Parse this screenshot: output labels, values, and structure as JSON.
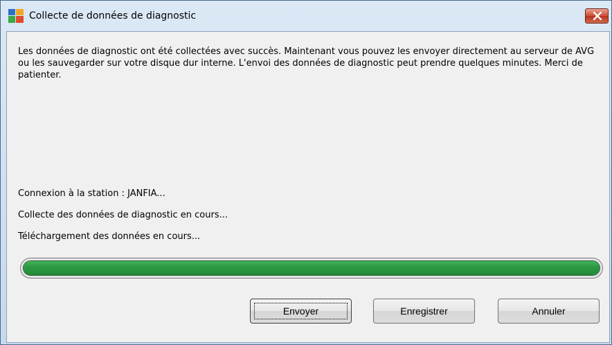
{
  "window": {
    "title": "Collecte de données de diagnostic",
    "close_icon": "close-icon"
  },
  "message": "Les données de diagnostic ont été collectées avec succès. Maintenant vous pouvez les envoyer directement au serveur de AVG ou les sauvegarder sur votre disque dur interne. L'envoi des données de diagnostic peut prendre quelques minutes. Merci de patienter.",
  "status_lines": [
    "Connexion à la station : JANFIA...",
    "Collecte des données de diagnostic en cours...",
    "Téléchargement des données en cours..."
  ],
  "progress": {
    "value": 1.0,
    "color": "#2d9944"
  },
  "buttons": {
    "send": "Envoyer",
    "save": "Enregistrer",
    "cancel": "Annuler"
  },
  "colors": {
    "close_button": "#c94f36",
    "window_frame": "#c7d9ec"
  }
}
